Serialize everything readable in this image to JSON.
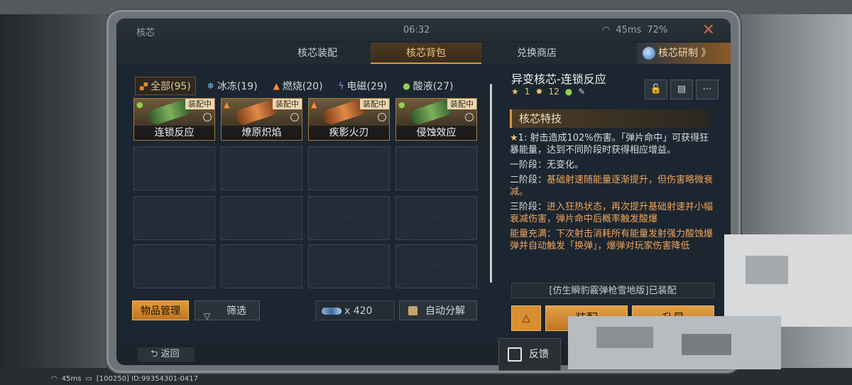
{
  "window": {
    "title": "核芯",
    "time": "06:32",
    "ping": "45ms",
    "battery": "72%",
    "close_label": "✕"
  },
  "tabs": [
    {
      "label": "核芯装配",
      "active": false
    },
    {
      "label": "核芯背包",
      "active": true
    },
    {
      "label": "兑换商店",
      "active": false
    }
  ],
  "research_tab": {
    "label": "核芯研制 》"
  },
  "filters": [
    {
      "label": "全部(95)",
      "icon": "grid-icon"
    },
    {
      "label": "冰冻(19)",
      "icon": "snowflake-icon"
    },
    {
      "label": "燃烧(20)",
      "icon": "flame-icon"
    },
    {
      "label": "电磁(29)",
      "icon": "lightning-icon"
    },
    {
      "label": "酸液(27)",
      "icon": "droplet-icon"
    }
  ],
  "cores": [
    {
      "name": "连锁反应",
      "badge": "装配中",
      "element": "acid",
      "color": "#8fd14f"
    },
    {
      "name": "燎原炽焰",
      "badge": "装配中",
      "element": "fire",
      "color": "#ff8a3a"
    },
    {
      "name": "疾影火刃",
      "badge": "装配中",
      "element": "fire",
      "color": "#ff8a3a"
    },
    {
      "name": "侵蚀效应",
      "badge": "装配中",
      "element": "acid",
      "color": "#8fd14f"
    }
  ],
  "bottom_controls": {
    "manage_label": "物品管理",
    "filter_label": "筛选",
    "currency_amount": "x 420",
    "auto_decompose_label": "自动分解",
    "back_label": "返回"
  },
  "detail": {
    "title": "异变核芯-连锁反应",
    "stat_star": "1",
    "stat_level": "12",
    "section_title": "核芯特技",
    "paragraph1": "1: 射击造成102%伤害。「弹片命中」可获得狂暴能量，达到不同阶段时获得相应增益。",
    "stage1": "一阶段：无变化。",
    "stage2_prefix": "二阶段：",
    "stage2_text": "基础射速随能量逐渐提升，但伤害略微衰减。",
    "stage3_prefix": "三阶段：",
    "stage3_text": "进入狂热状态，再次提升基础射速并小幅衰减伤害，弹片命中后概率触发酸爆",
    "full_energy": "能量充满：下次射击消耗所有能量发射强力酸蚀爆弹并自动触发「换弹」，爆弹对玩家伤害降低",
    "equipped_on": "[仿生瞬豹霰弹枪雪地版]已装配",
    "btn_equip": "装配",
    "btn_upgrade": "升星"
  },
  "feedback_label": "反馈",
  "footer": {
    "ping": "45ms",
    "id_text": "[100250] ID:99354301-0417"
  },
  "colors": {
    "accent_orange": "#d98e2f",
    "panel_bg": "#1c2630",
    "active_tab_text": "#f1c27a"
  }
}
